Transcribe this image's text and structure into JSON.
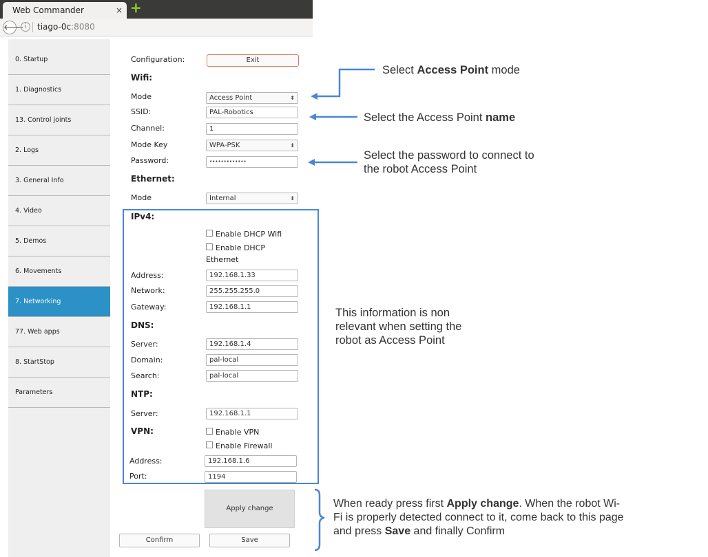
{
  "browser": {
    "tab_title": "Web Commander",
    "tab_close": "×",
    "new_tab": "+",
    "back": "🡐",
    "info": "i",
    "url_host": "tiago-0c",
    "url_port": ":8080"
  },
  "sidebar": {
    "items": [
      {
        "label": "0. Startup"
      },
      {
        "label": "1. Diagnostics"
      },
      {
        "label": "13. Control joints"
      },
      {
        "label": "2. Logs"
      },
      {
        "label": "3. General Info"
      },
      {
        "label": "4. Video"
      },
      {
        "label": "5. Demos"
      },
      {
        "label": "6. Movements"
      },
      {
        "label": "7. Networking"
      },
      {
        "label": "77. Web apps"
      },
      {
        "label": "8. StartStop"
      },
      {
        "label": "Parameters"
      }
    ],
    "active": "7. Networking"
  },
  "form": {
    "configuration_label": "Configuration:",
    "exit_label": "Exit",
    "wifi_header": "Wifi:",
    "wifi_mode_label": "Mode",
    "wifi_mode_value": "Access Point",
    "ssid_label": "SSID:",
    "ssid_value": "PAL-Robotics",
    "channel_label": "Channel:",
    "channel_value": "1",
    "mode_key_label": "Mode Key",
    "mode_key_value": "WPA-PSK",
    "password_label": "Password:",
    "password_value": "•••••••••••••",
    "ethernet_header": "Ethernet:",
    "ethernet_mode_label": "Mode",
    "ethernet_mode_value": "Internal",
    "ipv4_header": "IPv4:",
    "dhcp_wifi_label": "Enable DHCP Wifi",
    "dhcp_eth_label_1": "Enable DHCP",
    "dhcp_eth_label_2": "Ethernet",
    "address_label": "Address:",
    "address_value": "192.168.1.33",
    "network_label": "Network:",
    "network_value": "255.255.255.0",
    "gateway_label": "Gateway:",
    "gateway_value": "192.168.1.1",
    "dns_header": "DNS:",
    "dns_server_label": "Server:",
    "dns_server_value": "192.168.1.4",
    "domain_label": "Domain:",
    "domain_value": "pal-local",
    "search_label": "Search:",
    "search_value": "pal-local",
    "ntp_header": "NTP:",
    "ntp_server_label": "Server:",
    "ntp_server_value": "192.168.1.1",
    "vpn_header": "VPN:",
    "enable_vpn_label": "Enable VPN",
    "enable_firewall_label": "Enable Firewall",
    "vpn_address_label": "Address:",
    "vpn_address_value": "192.168.1.6",
    "port_label": "Port:",
    "port_value": "1194",
    "apply_label": "Apply change",
    "confirm_label": "Confirm",
    "save_label": "Save"
  },
  "annotations": {
    "mode_pre": "Select ",
    "mode_bold": "Access Point",
    "mode_post": " mode",
    "name_pre": "Select the Access Point ",
    "name_bold": "name",
    "password_line1": "Select the password to connect to",
    "password_line2": "the robot Access Point",
    "nonrelevant_line1": "This information is non",
    "nonrelevant_line2": "relevant when setting the",
    "nonrelevant_line3": "robot as Access Point",
    "final_1": "When ready press first ",
    "final_bold1": "Apply change",
    "final_2": ". When the robot Wi-",
    "final_3": "Fi is properly detected connect to it, come back to this page",
    "final_4": "and press ",
    "final_bold2": "Save",
    "final_5": " and finally Confirm"
  },
  "colors": {
    "accent_blue": "#4a86d8",
    "active_sidebar": "#2b91c6",
    "exit_border": "#e07a5a"
  }
}
